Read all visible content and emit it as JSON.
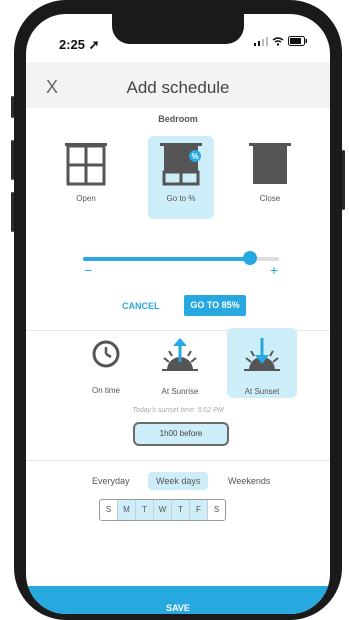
{
  "status_bar": {
    "time": "2:25"
  },
  "header": {
    "close_label": "X",
    "title": "Add schedule"
  },
  "room": "Bedroom",
  "position_options": [
    {
      "label": "Open",
      "icon": "window-open-icon",
      "selected": false
    },
    {
      "label": "Go to %",
      "icon": "shade-percent-icon",
      "selected": true,
      "badge": "%"
    },
    {
      "label": "Close",
      "icon": "shade-closed-icon",
      "selected": false
    }
  ],
  "slider": {
    "value_percent": 85,
    "minus_label": "−",
    "plus_label": "+"
  },
  "actions": {
    "cancel_label": "CANCEL",
    "goto_label": "GO TO 85%"
  },
  "trigger_options": [
    {
      "label": "On time",
      "icon": "clock-icon",
      "selected": false
    },
    {
      "label": "At Sunrise",
      "icon": "sunrise-icon",
      "selected": false
    },
    {
      "label": "At Sunset",
      "icon": "sunset-icon",
      "selected": true
    }
  ],
  "sunset_note": "Today's sunset time: 5:02 PM",
  "offset_label": "1h00 before",
  "frequency": {
    "options": [
      "Everyday",
      "Week days",
      "Weekends"
    ],
    "selected": "Week days"
  },
  "days": [
    {
      "label": "S",
      "selected": false
    },
    {
      "label": "M",
      "selected": true
    },
    {
      "label": "T",
      "selected": true
    },
    {
      "label": "W",
      "selected": true
    },
    {
      "label": "T",
      "selected": true
    },
    {
      "label": "F",
      "selected": true
    },
    {
      "label": "S",
      "selected": false
    }
  ],
  "save_label": "SAVE",
  "colors": {
    "accent": "#27a9e0",
    "highlight": "#cdeef8",
    "icon_gray": "#555555"
  }
}
